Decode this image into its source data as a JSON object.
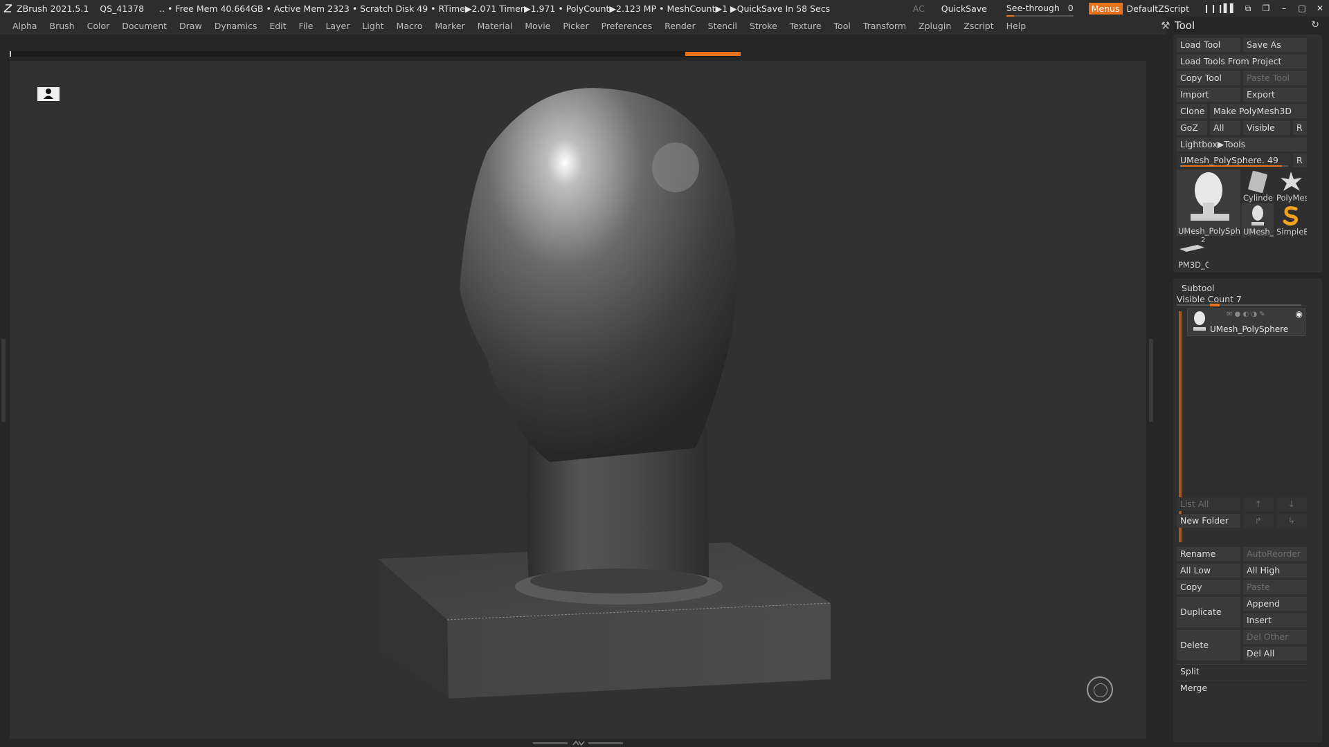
{
  "titlebar": {
    "app": "ZBrush 2021.5.1",
    "quicksave_id": "QS_41378",
    "status": ".. • Free Mem 40.664GB • Active Mem 2323 • Scratch Disk 49 •  RTime▶2.071 Timer▶1.971 • PolyCount▶2.123 MP  • MeshCount▶1   ▶QuickSave In 58 Secs",
    "ac": "AC",
    "quicksave": "QuickSave",
    "see_through_label": "See-through",
    "see_through_value": "0",
    "menus": "Menus",
    "default_zscript": "DefaultZScript"
  },
  "menubar": [
    "Alpha",
    "Brush",
    "Color",
    "Document",
    "Draw",
    "Dynamics",
    "Edit",
    "File",
    "Layer",
    "Light",
    "Macro",
    "Marker",
    "Material",
    "Movie",
    "Picker",
    "Preferences",
    "Render",
    "Stencil",
    "Stroke",
    "Texture",
    "Tool",
    "Transform",
    "Zplugin",
    "Zscript",
    "Help"
  ],
  "tool_panel": {
    "title": "Tool",
    "load_tool": "Load Tool",
    "save_as": "Save As",
    "load_tools_from_project": "Load Tools From Project",
    "copy_tool": "Copy Tool",
    "paste_tool": "Paste Tool",
    "import": "Import",
    "export": "Export",
    "clone": "Clone",
    "make_polymesh3d": "Make PolyMesh3D",
    "goz": "GoZ",
    "all": "All",
    "visible": "Visible",
    "r": "R",
    "lightbox_tools": "Lightbox▶Tools",
    "current_tool": "UMesh_PolySphere. 49",
    "current_tool_slider": 0.94,
    "thumbnails": {
      "main": "UMesh_PolySphe",
      "cylinder": "Cylinder",
      "polymesh": "PolyMes",
      "umesh_small": "UMesh_",
      "simplebrush": "SimpleB",
      "pm3d": "PM3D_C",
      "pm3d_count": "2"
    }
  },
  "subtool": {
    "title": "Subtool",
    "visible_count": "Visible Count 7",
    "item_name": "UMesh_PolySphere",
    "list_all": "List All",
    "new_folder": "New Folder",
    "rename": "Rename",
    "autoreorder": "AutoReorder",
    "all_low": "All Low",
    "all_high": "All High",
    "copy": "Copy",
    "paste": "Paste",
    "duplicate": "Duplicate",
    "append": "Append",
    "insert": "Insert",
    "delete": "Delete",
    "del_other": "Del Other",
    "del_all": "Del All",
    "split": "Split",
    "merge": "Merge"
  },
  "colors": {
    "accent": "#e8711e",
    "background": "#262626",
    "viewport": "#313131",
    "button": "#3a3a3a"
  }
}
